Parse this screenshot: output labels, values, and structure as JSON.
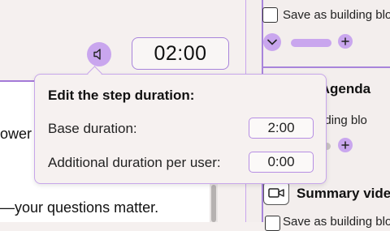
{
  "canvas": {
    "text_fragment_1": "ower",
    "text_fragment_2": "—your questions matter."
  },
  "controls": {
    "audio_icon": "speaker-icon",
    "timer": "02:00"
  },
  "right_panel": {
    "checkbox_1_label": "Save as building blo",
    "chevron_icon": "chevron-down-icon",
    "agenda_title_fragment": "t Agenda",
    "checkbox_2_label_fragment": "building blo",
    "video_icon": "video-camera-icon",
    "summary_title": "Summary vide",
    "checkbox_3_label": "Save as building blo"
  },
  "popup": {
    "title": "Edit the step duration:",
    "base_label": "Base duration:",
    "base_value": "2:00",
    "additional_label": "Additional duration per user:",
    "additional_value": "0:00"
  },
  "colors": {
    "accent": "#c9a6ee",
    "accent_border": "#a884db",
    "background": "#f5f0ef"
  }
}
